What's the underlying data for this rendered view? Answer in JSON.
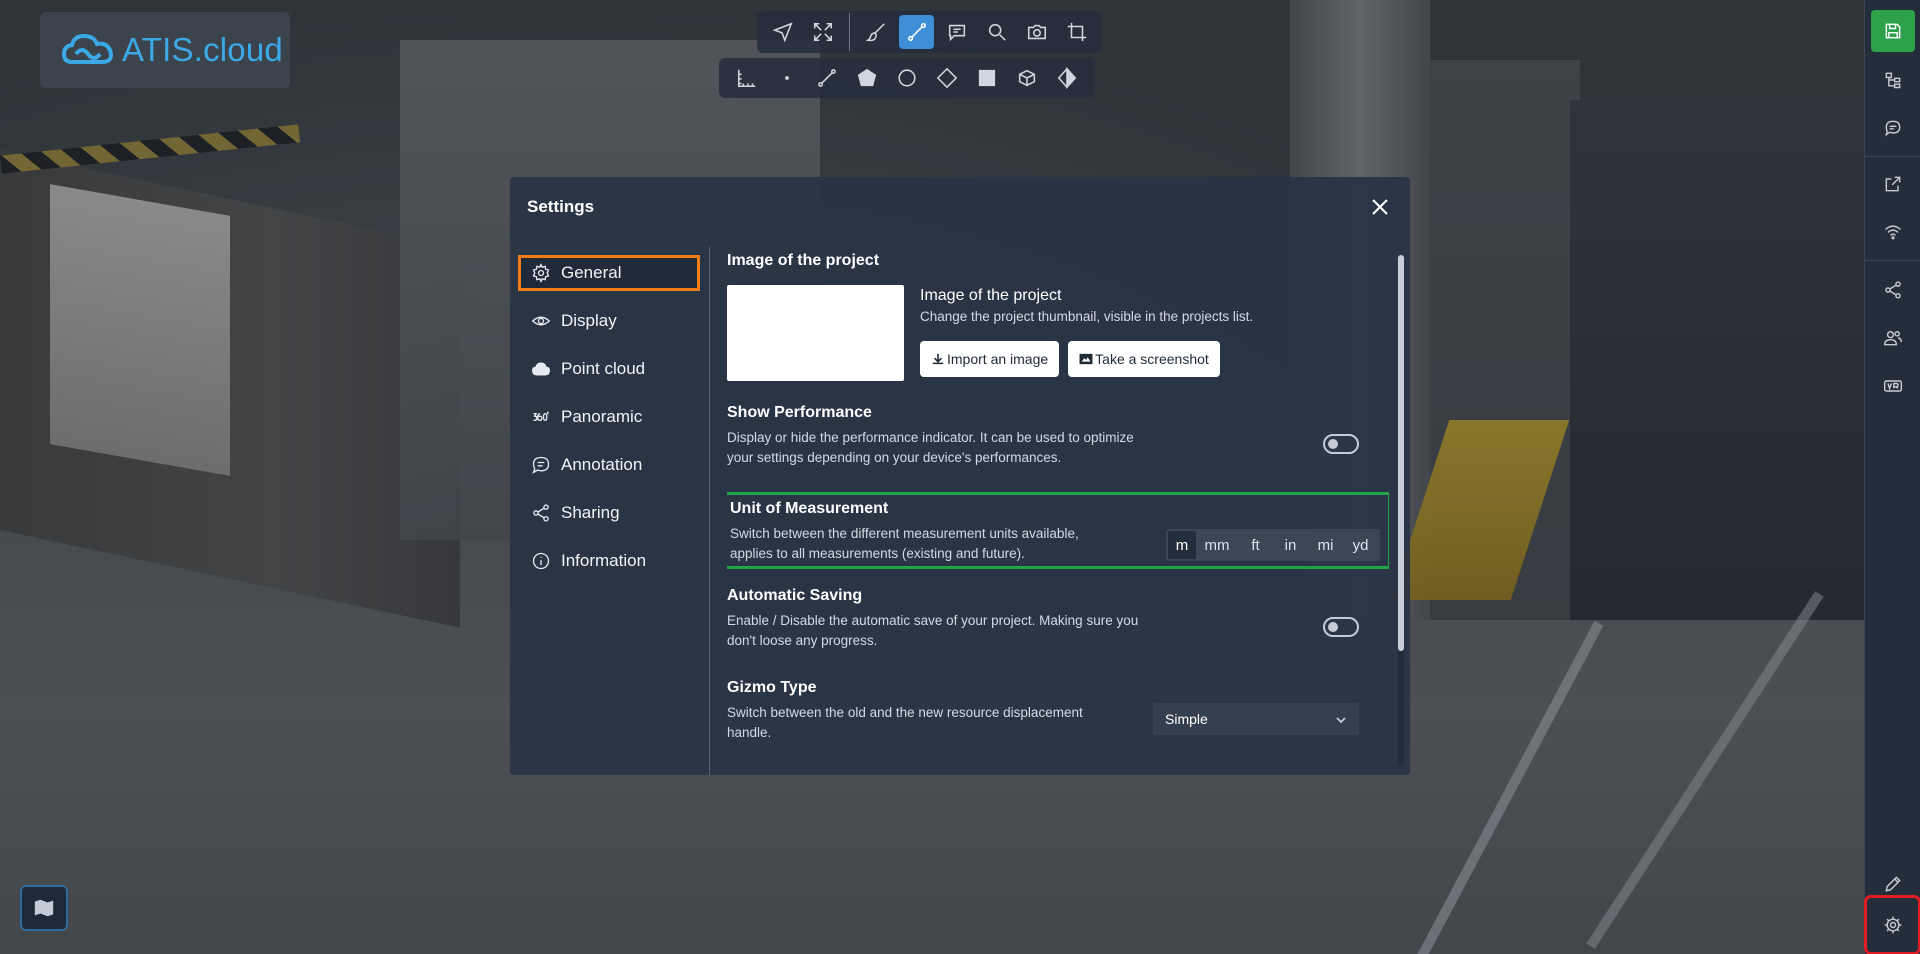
{
  "app": {
    "logo_text": "ATIS.cloud"
  },
  "top_toolbar": {
    "row1_icons": [
      "navigate-icon",
      "fullscreen-icon",
      "brush-icon",
      "measure-line-icon",
      "comment-icon",
      "zoom-icon",
      "camera-icon",
      "crop-icon"
    ],
    "row2_icons": [
      "ruler-icon",
      "point-icon",
      "line-icon",
      "polygon-icon",
      "circle-icon",
      "diamond-icon",
      "area-icon",
      "volume-icon",
      "cut-icon"
    ]
  },
  "settings": {
    "title": "Settings",
    "nav": [
      {
        "label": "General",
        "icon": "gear-icon"
      },
      {
        "label": "Display",
        "icon": "eye-icon"
      },
      {
        "label": "Point cloud",
        "icon": "cloud-icon"
      },
      {
        "label": "Panoramic",
        "icon": "panorama-360-icon"
      },
      {
        "label": "Annotation",
        "icon": "annotation-icon"
      },
      {
        "label": "Sharing",
        "icon": "share-icon"
      },
      {
        "label": "Information",
        "icon": "info-icon"
      }
    ],
    "image_section": {
      "title": "Image of the project",
      "subtitle": "Image of the project",
      "description": "Change the project thumbnail, visible in the projects list.",
      "import_label": "Import an image",
      "screenshot_label": "Take a screenshot"
    },
    "performance": {
      "title": "Show Performance",
      "description": "Display or hide the performance indicator. It can be used to optimize your settings depending on your device's performances.",
      "enabled": false
    },
    "unit": {
      "title": "Unit of Measurement",
      "description": "Switch between the different measurement units available, applies to all measurements (existing and future).",
      "options": [
        "m",
        "mm",
        "ft",
        "in",
        "mi",
        "yd"
      ],
      "selected": "m"
    },
    "autosave": {
      "title": "Automatic Saving",
      "description": "Enable / Disable the automatic save of your project. Making sure you don't loose any progress.",
      "enabled": false
    },
    "gizmo": {
      "title": "Gizmo Type",
      "description": "Switch between the old and the new resource displacement handle.",
      "value": "Simple"
    }
  },
  "right_sidebar": {
    "icons": [
      "save-icon",
      "tree-icon",
      "comments-icon",
      "external-link-icon",
      "wifi-icon",
      "share-icon",
      "users-icon",
      "vr-icon",
      "pen-icon",
      "settings-gear-icon"
    ]
  },
  "colors": {
    "accent": "#3f8fd6",
    "save_green": "#2ea24a",
    "highlight_orange": "#f07d18",
    "highlight_green": "#21a446",
    "highlight_red": "#e01d24"
  }
}
